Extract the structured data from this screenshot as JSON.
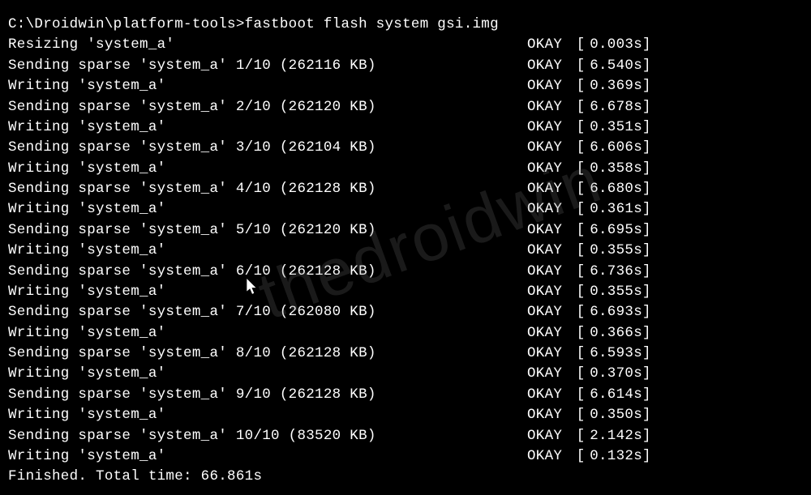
{
  "prompt": {
    "path": "C:\\Droidwin\\platform-tools>",
    "command": "fastboot flash system gsi.img"
  },
  "watermark": "thedroidwin",
  "lines": [
    {
      "left": "Resizing 'system_a'",
      "status": "OKAY",
      "time": "0.003s"
    },
    {
      "left": "Sending sparse 'system_a' 1/10 (262116 KB)",
      "status": "OKAY",
      "time": "6.540s"
    },
    {
      "left": "Writing 'system_a'",
      "status": "OKAY",
      "time": "0.369s"
    },
    {
      "left": "Sending sparse 'system_a' 2/10 (262120 KB)",
      "status": "OKAY",
      "time": "6.678s"
    },
    {
      "left": "Writing 'system_a'",
      "status": "OKAY",
      "time": "0.351s"
    },
    {
      "left": "Sending sparse 'system_a' 3/10 (262104 KB)",
      "status": "OKAY",
      "time": "6.606s"
    },
    {
      "left": "Writing 'system_a'",
      "status": "OKAY",
      "time": "0.358s"
    },
    {
      "left": "Sending sparse 'system_a' 4/10 (262128 KB)",
      "status": "OKAY",
      "time": "6.680s"
    },
    {
      "left": "Writing 'system_a'",
      "status": "OKAY",
      "time": "0.361s"
    },
    {
      "left": "Sending sparse 'system_a' 5/10 (262120 KB)",
      "status": "OKAY",
      "time": "6.695s"
    },
    {
      "left": "Writing 'system_a'",
      "status": "OKAY",
      "time": "0.355s"
    },
    {
      "left": "Sending sparse 'system_a' 6/10 (262128 KB)",
      "status": "OKAY",
      "time": "6.736s"
    },
    {
      "left": "Writing 'system_a'",
      "status": "OKAY",
      "time": "0.355s"
    },
    {
      "left": "Sending sparse 'system_a' 7/10 (262080 KB)",
      "status": "OKAY",
      "time": "6.693s"
    },
    {
      "left": "Writing 'system_a'",
      "status": "OKAY",
      "time": "0.366s"
    },
    {
      "left": "Sending sparse 'system_a' 8/10 (262128 KB)",
      "status": "OKAY",
      "time": "6.593s"
    },
    {
      "left": "Writing 'system_a'",
      "status": "OKAY",
      "time": "0.370s"
    },
    {
      "left": "Sending sparse 'system_a' 9/10 (262128 KB)",
      "status": "OKAY",
      "time": "6.614s"
    },
    {
      "left": "Writing 'system_a'",
      "status": "OKAY",
      "time": "0.350s"
    },
    {
      "left": "Sending sparse 'system_a' 10/10 (83520 KB)",
      "status": "OKAY",
      "time": "2.142s"
    },
    {
      "left": "Writing 'system_a'",
      "status": "OKAY",
      "time": "0.132s"
    }
  ],
  "final": "Finished. Total time: 66.861s",
  "brackets": {
    "left": "[",
    "right": "]"
  }
}
